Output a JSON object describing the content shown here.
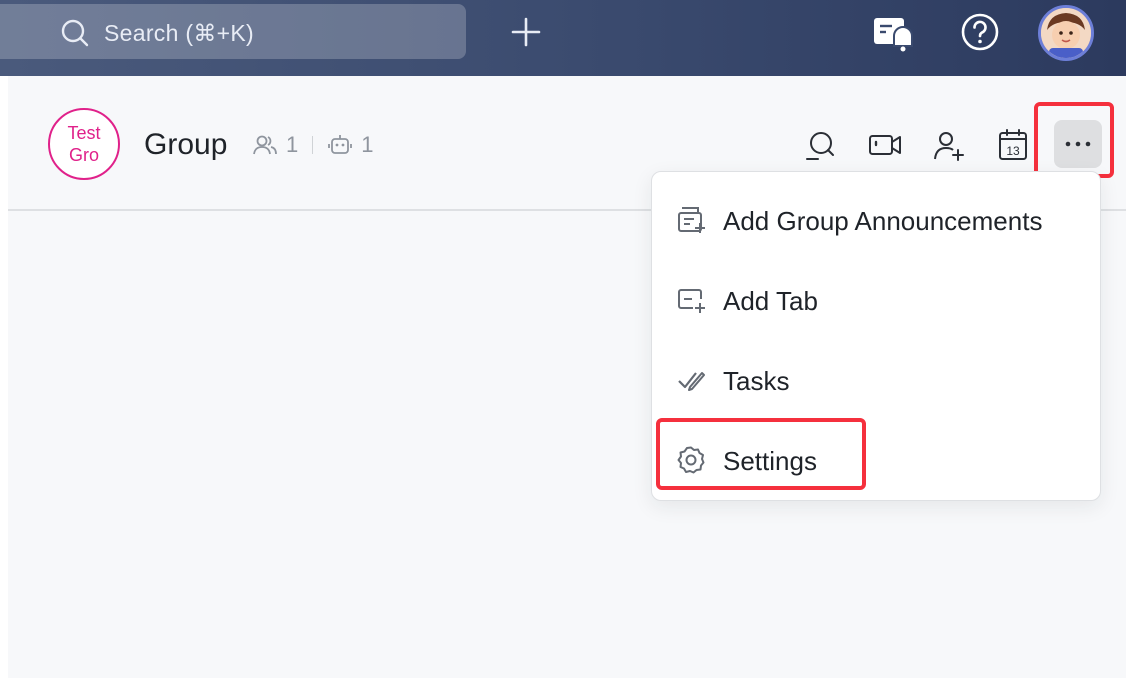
{
  "topbar": {
    "search_placeholder": "Search (⌘+K)",
    "new_icon": "plus-icon",
    "notification_icon": "notification-bell-icon",
    "help_icon": "help-icon"
  },
  "chat": {
    "avatar_text_line1": "Test",
    "avatar_text_line2": "Gro",
    "title": "Group",
    "member_count": "1",
    "bot_count": "1"
  },
  "header_actions": [
    "search-chat",
    "video-call",
    "add-member",
    "calendar",
    "more"
  ],
  "calendar_day": "13",
  "menu": {
    "items": [
      {
        "label": "Add Group Announcements",
        "icon": "announcement-icon"
      },
      {
        "label": "Add Tab",
        "icon": "add-tab-icon"
      },
      {
        "label": "Tasks",
        "icon": "tasks-icon"
      },
      {
        "label": "Settings",
        "icon": "gear-icon"
      }
    ]
  },
  "colors": {
    "accent_highlight": "#f5303d",
    "group_avatar": "#e0218a",
    "topbar_start": "#4a5a7c",
    "topbar_end": "#2c3a5e"
  }
}
